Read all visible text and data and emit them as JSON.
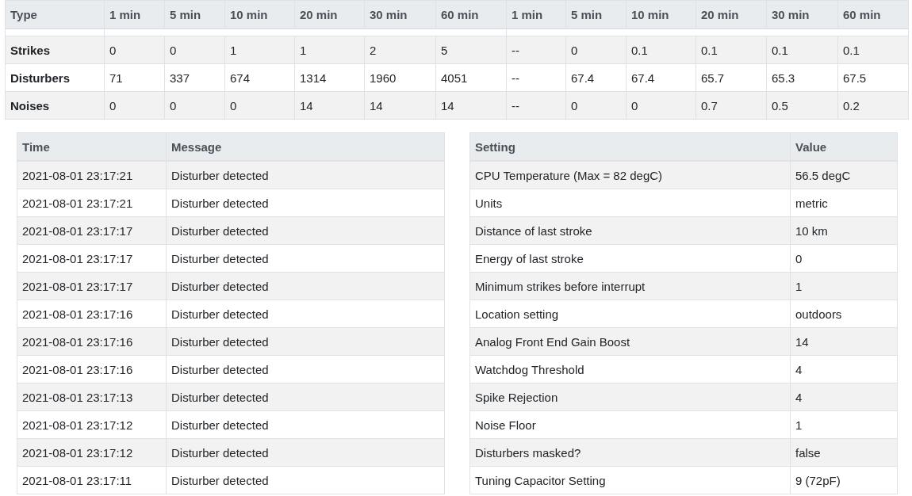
{
  "stats_table": {
    "columns": [
      "Type",
      "1 min",
      "5 min",
      "10 min",
      "20 min",
      "30 min",
      "60 min",
      "1 min",
      "5 min",
      "10 min",
      "20 min",
      "30 min",
      "60 min"
    ],
    "rows": [
      [
        "Strikes",
        "0",
        "0",
        "1",
        "1",
        "2",
        "5",
        "--",
        "0",
        "0.1",
        "0.1",
        "0.1",
        "0.1"
      ],
      [
        "Disturbers",
        "71",
        "337",
        "674",
        "1314",
        "1960",
        "4051",
        "--",
        "67.4",
        "67.4",
        "65.7",
        "65.3",
        "67.5"
      ],
      [
        "Noises",
        "0",
        "0",
        "0",
        "14",
        "14",
        "14",
        "--",
        "0",
        "0",
        "0.7",
        "0.5",
        "0.2"
      ]
    ]
  },
  "event_log": {
    "columns": [
      "Time",
      "Message"
    ],
    "rows": [
      [
        "2021-08-01 23:17:21",
        "Disturber detected"
      ],
      [
        "2021-08-01 23:17:21",
        "Disturber detected"
      ],
      [
        "2021-08-01 23:17:17",
        "Disturber detected"
      ],
      [
        "2021-08-01 23:17:17",
        "Disturber detected"
      ],
      [
        "2021-08-01 23:17:17",
        "Disturber detected"
      ],
      [
        "2021-08-01 23:17:16",
        "Disturber detected"
      ],
      [
        "2021-08-01 23:17:16",
        "Disturber detected"
      ],
      [
        "2021-08-01 23:17:16",
        "Disturber detected"
      ],
      [
        "2021-08-01 23:17:13",
        "Disturber detected"
      ],
      [
        "2021-08-01 23:17:12",
        "Disturber detected"
      ],
      [
        "2021-08-01 23:17:12",
        "Disturber detected"
      ],
      [
        "2021-08-01 23:17:11",
        "Disturber detected"
      ]
    ]
  },
  "settings": {
    "columns": [
      "Setting",
      "Value"
    ],
    "rows": [
      [
        "CPU Temperature (Max = 82 degC)",
        "56.5 degC"
      ],
      [
        "Units",
        "metric"
      ],
      [
        "Distance of last stroke",
        "10 km"
      ],
      [
        "Energy of last stroke",
        "0"
      ],
      [
        "Minimum strikes before interrupt",
        "1"
      ],
      [
        "Location setting",
        "outdoors"
      ],
      [
        "Analog Front End Gain Boost",
        "14"
      ],
      [
        "Watchdog Threshold",
        "4"
      ],
      [
        "Spike Rejection",
        "4"
      ],
      [
        "Noise Floor",
        "1"
      ],
      [
        "Disturbers masked?",
        "false"
      ],
      [
        "Tuning Capacitor Setting",
        "9 (72pF)"
      ]
    ]
  }
}
